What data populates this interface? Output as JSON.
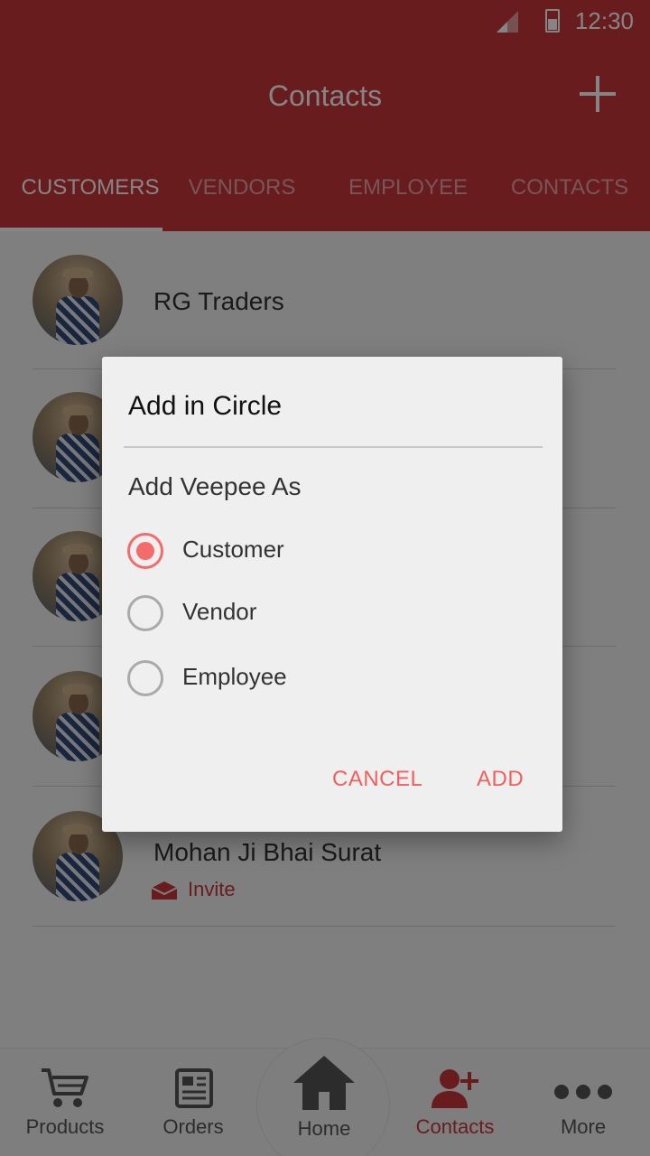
{
  "status_bar": {
    "time": "12:30"
  },
  "app_bar": {
    "title": "Contacts"
  },
  "tabs": [
    {
      "label": "CUSTOMERS"
    },
    {
      "label": "VENDORS"
    },
    {
      "label": "EMPLOYEE"
    },
    {
      "label": "CONTACTS"
    }
  ],
  "contacts": [
    {
      "name": "RG Traders"
    },
    {
      "name": "Mohan Ji Bhai Surat",
      "action": "Invite"
    }
  ],
  "dialog": {
    "title": "Add in Circle",
    "subtitle": "Add Veepee As",
    "options": [
      {
        "label": "Customer",
        "selected": true
      },
      {
        "label": "Vendor",
        "selected": false
      },
      {
        "label": "Employee",
        "selected": false
      }
    ],
    "cancel_label": "CANCEL",
    "add_label": "ADD"
  },
  "bottom_nav": [
    {
      "label": "Products",
      "icon": "cart-icon"
    },
    {
      "label": "Orders",
      "icon": "orders-icon"
    },
    {
      "label": "Home",
      "icon": "home-icon"
    },
    {
      "label": "Contacts",
      "icon": "add-contact-icon",
      "active": true
    },
    {
      "label": "More",
      "icon": "more-icon"
    }
  ],
  "colors": {
    "brand": "#c8363b",
    "accent": "#f36b6b"
  }
}
